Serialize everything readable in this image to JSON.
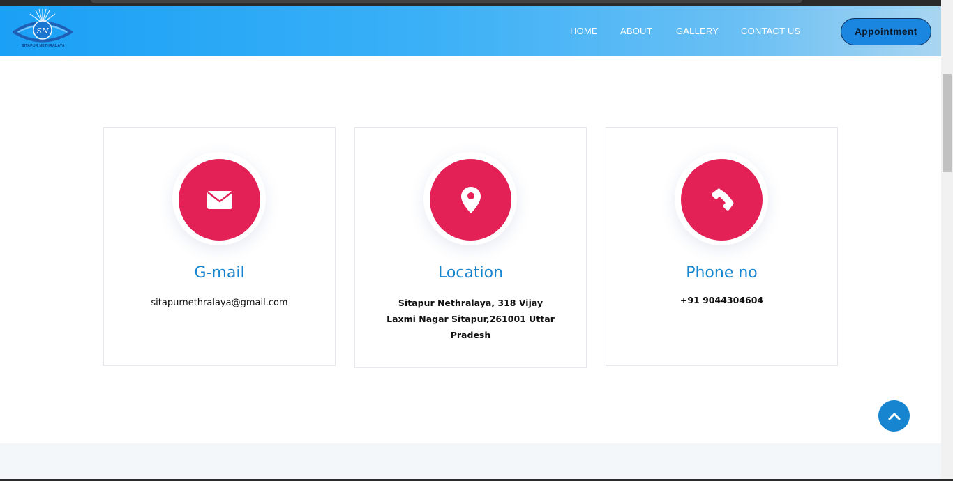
{
  "brand": {
    "logo_text": "SITAPUR NETHRALAYA",
    "logo_monogram": "SN"
  },
  "nav": {
    "home": "HOME",
    "about": "ABOUT",
    "gallery": "GALLERY",
    "contact": "CONTACT US",
    "appointment": "Appointment"
  },
  "cards": [
    {
      "icon": "envelope-icon",
      "title": "G-mail",
      "text": "sitapurnethralaya@gmail.com"
    },
    {
      "icon": "map-pin-icon",
      "title": "Location",
      "text": "Sitapur Nethralaya, 318 Vijay Laxmi Nagar Sitapur,261001 Uttar Pradesh"
    },
    {
      "icon": "phone-icon",
      "title": "Phone no",
      "text": "+91 9044304604"
    }
  ],
  "back_to_top": {
    "icon": "chevron-up-icon"
  },
  "colors": {
    "accent_red": "#e32157",
    "title_blue": "#1785cf",
    "nav_gradient_start": "#1aa0f6",
    "nav_gradient_end": "#a9d6f1"
  }
}
